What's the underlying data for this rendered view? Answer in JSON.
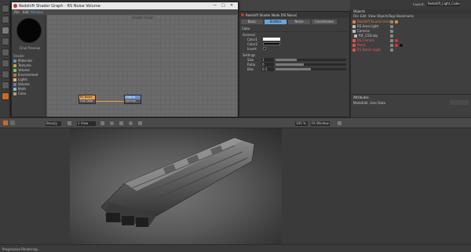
{
  "app": {
    "layout_label": "Layout:",
    "layout_value": "Redshift_Light_Cube"
  },
  "shader_window": {
    "title": "Redshift Shader Graph - RS Noise Volume",
    "menu": [
      "File",
      "Edit",
      "Window"
    ],
    "canvas_title": "Shader Graph",
    "preview_label": "Final Preview",
    "node_list_title": "Shader",
    "node_list": [
      "Materials",
      "Textures",
      "Volume",
      "Environment",
      "Lights",
      "Volume",
      "Math",
      "Color"
    ],
    "nodes": [
      {
        "title": "RS Noise",
        "port": "Out Color"
      },
      {
        "title": "Output",
        "port": "Volume"
      }
    ]
  },
  "prop_panel": {
    "title": "Redshift Shader Node [RS Noise]",
    "tabs": [
      "Basic",
      "Scatter",
      "Noise",
      "Coordinates"
    ],
    "section_color": "Color",
    "group_general": "General",
    "rows_general": [
      {
        "label": "Color1",
        "value": ""
      },
      {
        "label": "Color2",
        "value": ""
      },
      {
        "label": "Invert",
        "value": ""
      }
    ],
    "group_settings": "Settings",
    "rows_settings": [
      {
        "label": "Size",
        "value": "1"
      },
      {
        "label": "Ratio",
        "value": "0"
      },
      {
        "label": "Bias",
        "value": "0.5"
      }
    ]
  },
  "object_manager": {
    "tabs": [
      "Objects",
      "Takes",
      "Content Browser"
    ],
    "menu": [
      "File",
      "Edit",
      "View",
      "Objects",
      "Tags",
      "Bookmarks"
    ],
    "objects": [
      {
        "name": "Redshift Environment",
        "color": "#e07a4a"
      },
      {
        "name": "RS Area Light",
        "color": "#d9d9d9"
      },
      {
        "name": "Camera",
        "color": "#d9d9d9"
      },
      {
        "name": "RIF_CSD.obj",
        "color": "#d9d9d9"
      },
      {
        "name": "RS Camera",
        "color": "#e05050"
      },
      {
        "name": "Plane",
        "color": "#e05050"
      },
      {
        "name": "RS Dome Light",
        "color": "#e05050"
      }
    ]
  },
  "attribute_manager": {
    "title": "Attributes",
    "menu": [
      "Mode",
      "Edit",
      "User Data"
    ]
  },
  "render_view": {
    "menu": [
      "File",
      "View",
      "Window"
    ],
    "dropdown_left": "Beauty",
    "dropdown_mid": "1 View",
    "zoom": "100 %",
    "dropdown_right": "Fit Window"
  },
  "status": {
    "text": "Progressive Rendering..."
  },
  "colors": {
    "accent_orange": "#e08a2a",
    "node_orange": "#e8a050",
    "node_blue": "#6a8fc8",
    "tab_active": "#6aa3d8"
  }
}
